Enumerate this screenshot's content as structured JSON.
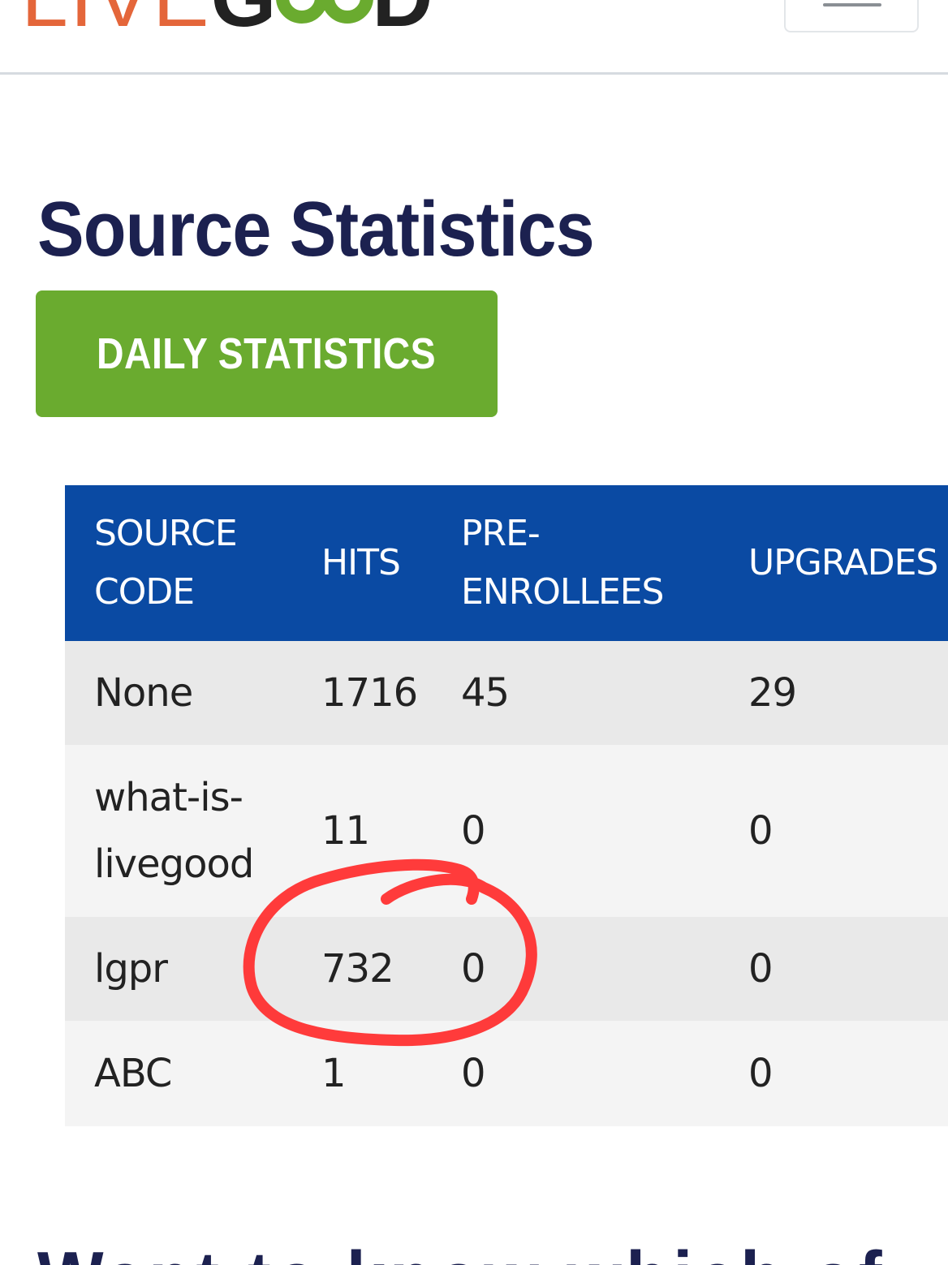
{
  "header": {
    "logo_text": "LIVEGOOD",
    "menu_icon": "hamburger-menu-icon"
  },
  "main": {
    "title": "Source Statistics",
    "daily_button_label": "DAILY STATISTICS",
    "next_heading": "Want to know which of"
  },
  "table": {
    "headers": [
      {
        "line1": "SOURCE",
        "line2": "CODE"
      },
      {
        "line1": "HITS",
        "line2": ""
      },
      {
        "line1": "PRE-",
        "line2": "ENROLLEES"
      },
      {
        "line1": "UPGRADES",
        "line2": ""
      }
    ],
    "rows": [
      {
        "source_line1": "None",
        "source_line2": "",
        "hits": "1716",
        "pre_enrollees": "45",
        "upgrades": "29"
      },
      {
        "source_line1": "what-is-",
        "source_line2": "livegood",
        "hits": "11",
        "pre_enrollees": "0",
        "upgrades": "0"
      },
      {
        "source_line1": "lgpr",
        "source_line2": "",
        "hits": "732",
        "pre_enrollees": "0",
        "upgrades": "0"
      },
      {
        "source_line1": "ABC",
        "source_line2": "",
        "hits": "1",
        "pre_enrollees": "0",
        "upgrades": "0"
      }
    ]
  },
  "colors": {
    "brand_green": "#6aab2f",
    "brand_orange": "#e4663a",
    "table_header_blue": "#0a4aa3",
    "title_navy": "#1c2150",
    "annotation_red": "#ff2a2a"
  }
}
